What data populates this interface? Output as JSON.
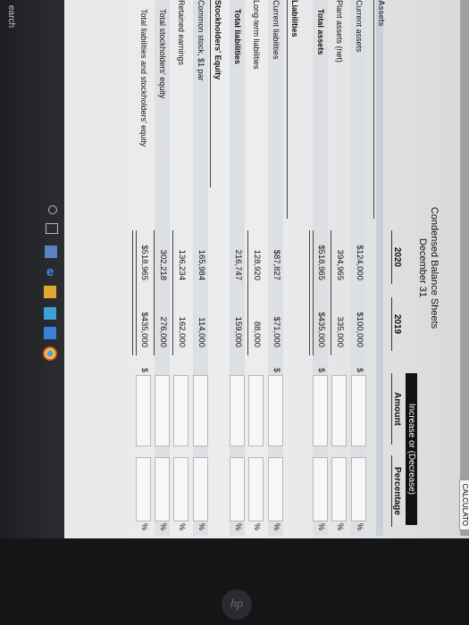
{
  "window": {
    "calc_tab": "CALCULATO",
    "title": "Condensed Balance Sheets",
    "subtitle": "December 31"
  },
  "headers": {
    "increase": "Increase or (Decrease)",
    "year1": "2020",
    "year2": "2019",
    "amount": "Amount",
    "percentage": "Percentage"
  },
  "sections": {
    "assets": "Assets",
    "liabilities": "Liabilities",
    "equity": "Stockholders' Equity"
  },
  "rows": [
    {
      "label": "Current assets",
      "y2020": "$124,000",
      "y2019": "$100,000",
      "dollar": "$",
      "pct": "%"
    },
    {
      "label": "Plant assets (net)",
      "y2020": "394,965",
      "y2019": "335,000",
      "dollar": "",
      "pct": "%"
    },
    {
      "label": "Total assets",
      "y2020": "$518,965",
      "y2019": "$435,000",
      "dollar": "$",
      "pct": "%"
    },
    {
      "label": "Current liabilities",
      "y2020": "$87,827",
      "y2019": "$71,000",
      "dollar": "$",
      "pct": "%"
    },
    {
      "label": "Long-term liabilities",
      "y2020": "128,920",
      "y2019": "88,000",
      "dollar": "",
      "pct": "%"
    },
    {
      "label": "Total liabilities",
      "y2020": "216,747",
      "y2019": "159,000",
      "dollar": "",
      "pct": "%"
    },
    {
      "label": "Common stock, $1 par",
      "y2020": "165,984",
      "y2019": "114,000",
      "dollar": "",
      "pct": "%"
    },
    {
      "label": "Retained earnings",
      "y2020": "136,234",
      "y2019": "162,000",
      "dollar": "",
      "pct": "%"
    },
    {
      "label": "Total stockholders' equity",
      "y2020": "302,218",
      "y2019": "276,000",
      "dollar": "",
      "pct": "%"
    },
    {
      "label": "Total liabilities and stockholders' equity",
      "y2020": "$518,965",
      "y2019": "$435,000",
      "dollar": "$",
      "pct": "%"
    }
  ],
  "taskbar": {
    "search": "earch"
  },
  "bezel": {
    "logo": "hp"
  }
}
